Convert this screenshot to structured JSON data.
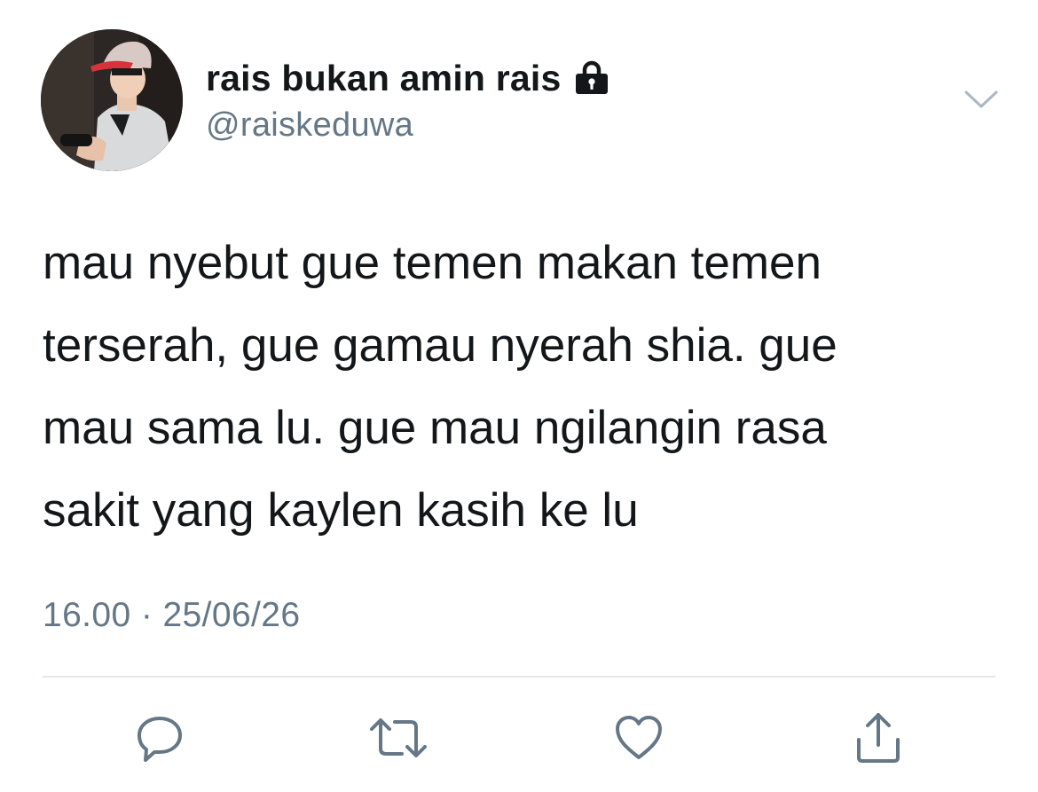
{
  "user": {
    "display_name": "rais bukan amin rais",
    "handle": "@raiskeduwa",
    "protected_icon": "lock-icon",
    "avatar": "avatar-photo"
  },
  "tweet": {
    "text": "mau nyebut gue temen makan temen\nterserah, gue gamau nyerah shia. gue\nmau sama lu. gue mau ngilangin rasa\nsakit yang kaylen kasih ke lu",
    "timestamp": "16.00 · 25/06/26"
  },
  "menu": {
    "icon": "chevron-down-icon"
  },
  "actions": [
    {
      "icon": "reply-icon"
    },
    {
      "icon": "retweet-icon"
    },
    {
      "icon": "like-icon"
    },
    {
      "icon": "share-icon"
    }
  ],
  "colors": {
    "text": "#14171a",
    "secondary": "#657786",
    "divider": "#e1e8ed",
    "icon": "#657786"
  }
}
